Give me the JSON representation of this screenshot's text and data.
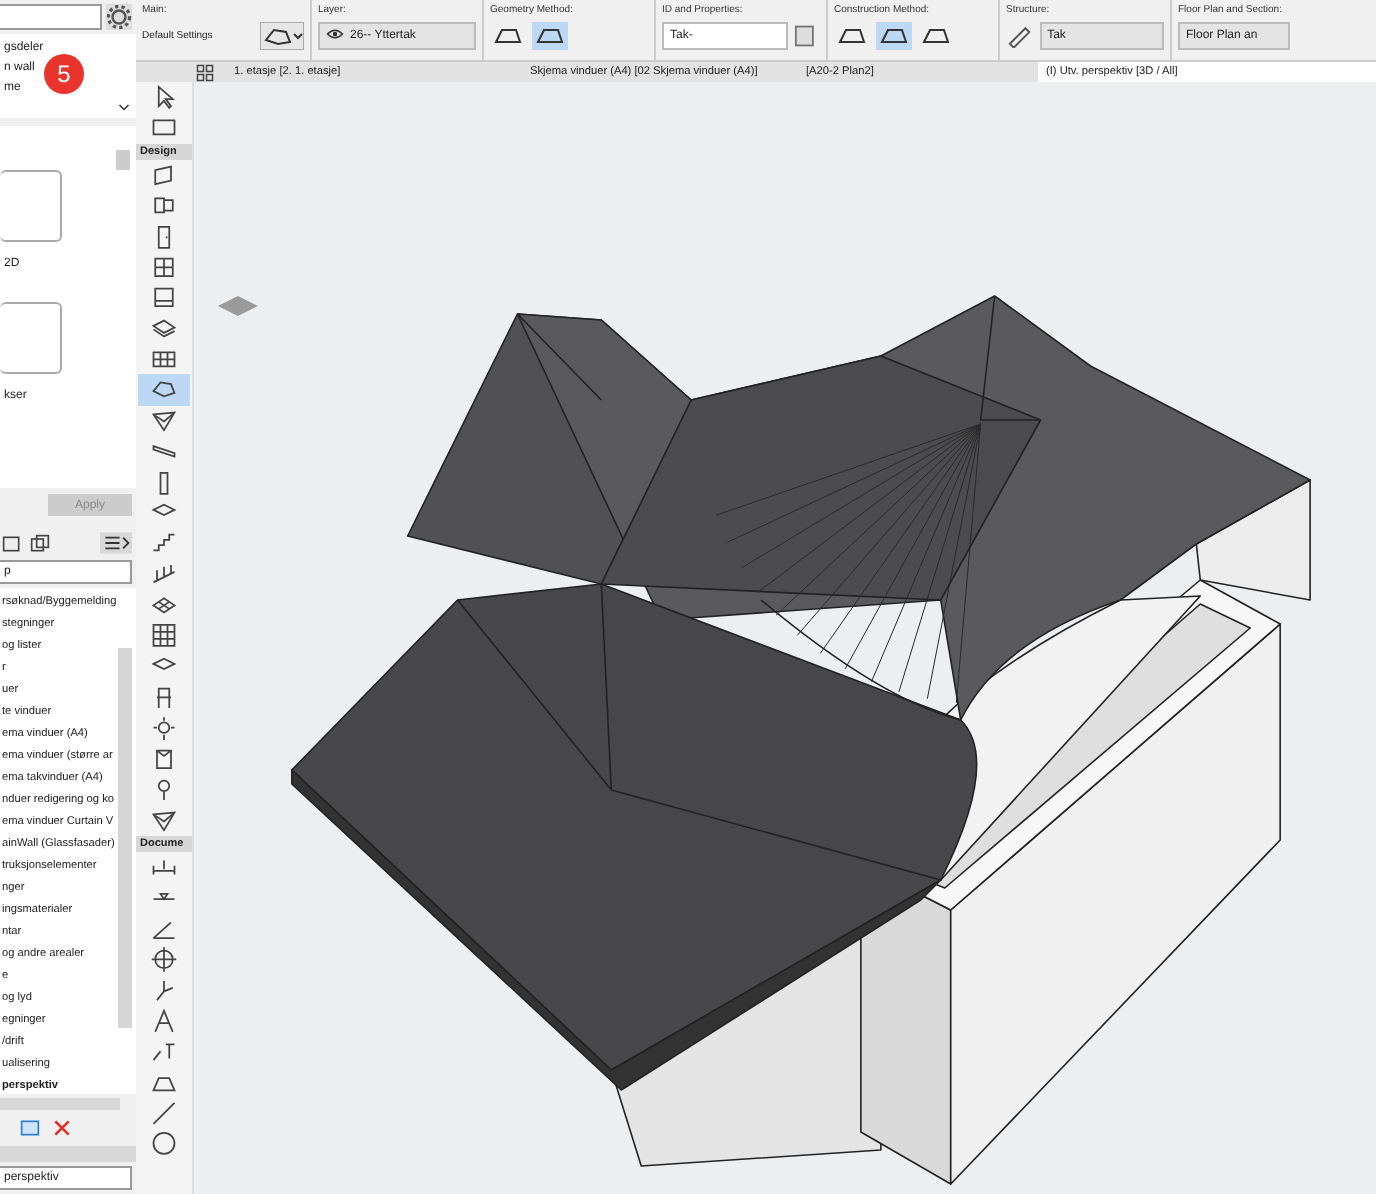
{
  "left_panel": {
    "navigator_items": [
      {
        "label": "gsdeler"
      },
      {
        "label": "n wall"
      },
      {
        "label": "me"
      }
    ],
    "badge": "5",
    "settings_labels": [
      "2D",
      "kser"
    ],
    "apply_button": {
      "label": "Apply",
      "disabled": true
    },
    "filter_field": {
      "value": "p"
    },
    "tree": [
      {
        "label": "rsøknad/Byggemelding",
        "selected": false
      },
      {
        "label": "stegninger",
        "selected": false
      },
      {
        "label": "og lister",
        "selected": false
      },
      {
        "label": "r",
        "selected": false
      },
      {
        "label": "uer",
        "selected": false
      },
      {
        "label": "te vinduer",
        "selected": false
      },
      {
        "label": "ema vinduer (A4)",
        "selected": false
      },
      {
        "label": "ema vinduer (større ar",
        "selected": false
      },
      {
        "label": "ema takvinduer (A4)",
        "selected": false
      },
      {
        "label": "nduer redigering og ko",
        "selected": false
      },
      {
        "label": "ema vinduer Curtain V",
        "selected": false
      },
      {
        "label": "ainWall (Glassfasader)",
        "selected": false
      },
      {
        "label": "truksjonselementer",
        "selected": false
      },
      {
        "label": "nger",
        "selected": false
      },
      {
        "label": "ingsmaterialer",
        "selected": false
      },
      {
        "label": "ntar",
        "selected": false
      },
      {
        "label": "og andre arealer",
        "selected": false
      },
      {
        "label": "e",
        "selected": false
      },
      {
        "label": "og lyd",
        "selected": false
      },
      {
        "label": "egninger",
        "selected": false
      },
      {
        "label": "/drift",
        "selected": false
      },
      {
        "label": "ualisering",
        "selected": false
      },
      {
        "label": "perspektiv",
        "selected": true
      }
    ],
    "bottom_field": {
      "value": "perspektiv"
    }
  },
  "info_box": {
    "groups": [
      {
        "label": "Main:",
        "kind": "main",
        "text": "Default Settings"
      },
      {
        "label": "Layer:",
        "kind": "layer",
        "text": "26-- Yttertak"
      },
      {
        "label": "Geometry Method:",
        "kind": "geometry",
        "options": [
          {
            "selected": false
          },
          {
            "selected": true
          }
        ]
      },
      {
        "label": "ID and Properties:",
        "kind": "id",
        "text": "Tak-"
      },
      {
        "label": "Construction Method:",
        "kind": "construction",
        "options": [
          {
            "selected": false
          },
          {
            "selected": true
          },
          {
            "selected": false
          }
        ]
      },
      {
        "label": "Structure:",
        "kind": "structure",
        "text": "Tak"
      },
      {
        "label": "Floor Plan and Section:",
        "kind": "floorplan",
        "text": "Floor Plan an"
      }
    ]
  },
  "tabs": [
    {
      "label": "1. etasje [2. 1. etasje]",
      "kind": "plan",
      "selected": false
    },
    {
      "label": "Skjema vinduer (A4) [02 Skjema vinduer (A4)]",
      "kind": "schedule",
      "selected": false
    },
    {
      "label": "[A20-2 Plan2]",
      "kind": "layout",
      "selected": false
    },
    {
      "label": "(I) Utv. perspektiv [3D / All]",
      "kind": "perspective",
      "selected": true
    }
  ],
  "toolbox": {
    "top_tools": [
      {
        "kind": "arrow",
        "selected": false
      },
      {
        "kind": "marquee",
        "selected": false
      }
    ],
    "sections": [
      {
        "label": "Design",
        "tools": [
          {
            "kind": "wall",
            "selected": false
          },
          {
            "kind": "column",
            "selected": false
          },
          {
            "kind": "door",
            "selected": false
          },
          {
            "kind": "window",
            "selected": false
          },
          {
            "kind": "skylight",
            "selected": false
          },
          {
            "kind": "slab",
            "selected": false
          },
          {
            "kind": "curtain",
            "selected": false
          },
          {
            "kind": "roof",
            "selected": true
          },
          {
            "kind": "shell",
            "selected": false
          },
          {
            "kind": "beam",
            "selected": false
          },
          {
            "kind": "pillar",
            "selected": false
          },
          {
            "kind": "zone",
            "selected": false
          },
          {
            "kind": "stair",
            "selected": false
          },
          {
            "kind": "railing",
            "selected": false
          },
          {
            "kind": "mesh",
            "selected": false
          },
          {
            "kind": "grid",
            "selected": false
          },
          {
            "kind": "zone",
            "selected": false
          },
          {
            "kind": "object",
            "selected": false
          },
          {
            "kind": "lamp",
            "selected": false
          },
          {
            "kind": "morph",
            "selected": false
          },
          {
            "kind": "marker",
            "selected": false
          },
          {
            "kind": "shell",
            "selected": false
          }
        ]
      },
      {
        "label": "Docume",
        "tools": [
          {
            "kind": "dimension",
            "selected": false
          },
          {
            "kind": "level",
            "selected": false
          },
          {
            "kind": "angle",
            "selected": false
          },
          {
            "kind": "target",
            "selected": false
          },
          {
            "kind": "elevation",
            "selected": false
          },
          {
            "kind": "text",
            "selected": false
          },
          {
            "kind": "label",
            "selected": false
          },
          {
            "kind": "fill",
            "selected": false
          },
          {
            "kind": "line",
            "selected": false
          },
          {
            "kind": "circle",
            "selected": false
          }
        ]
      }
    ]
  }
}
